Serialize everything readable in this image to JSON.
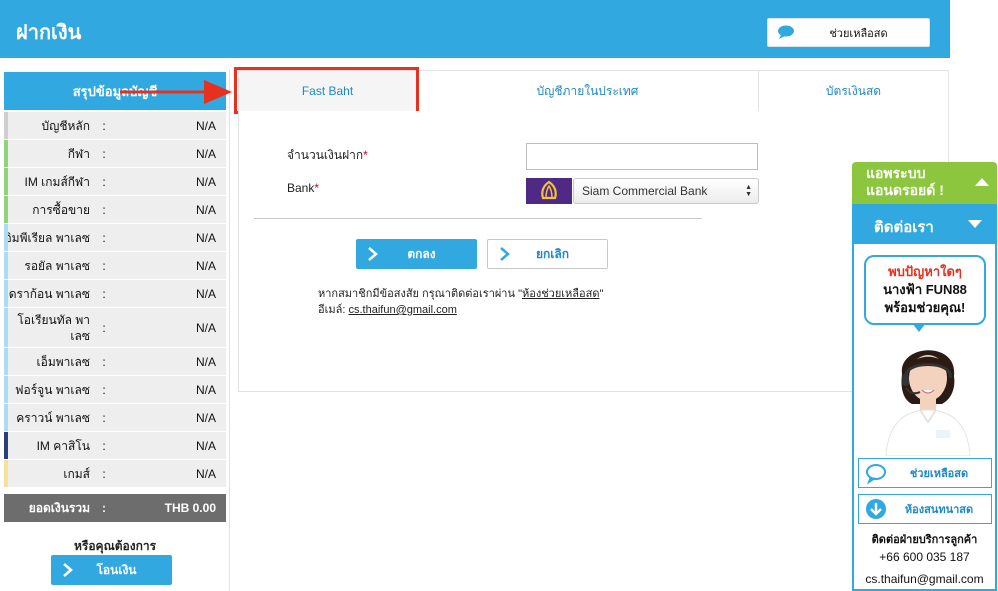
{
  "header": {
    "title": "ฝากเงิน",
    "help_label": "ช่วยเหลือสด"
  },
  "sidebar": {
    "title": "สรุปข้อมูลบัญชี",
    "rows": [
      {
        "name": "บัญชีหลัก",
        "value": "N/A",
        "color": "#cfcfcf"
      },
      {
        "name": "กีฬา",
        "value": "N/A",
        "color": "#8fd47a"
      },
      {
        "name": "IM เกมส์กีฬา",
        "value": "N/A",
        "color": "#8fd47a"
      },
      {
        "name": "การซื้อขาย",
        "value": "N/A",
        "color": "#8fd47a"
      },
      {
        "name": "อิมพีเรียล พาเลซ",
        "value": "N/A",
        "color": "#a9dcf5"
      },
      {
        "name": "รอยัล พาเลซ",
        "value": "N/A",
        "color": "#a9dcf5"
      },
      {
        "name": "ดราก้อน พาเลซ",
        "value": "N/A",
        "color": "#a9dcf5"
      },
      {
        "name": "โอเรียนทัล พาเลซ",
        "value": "N/A",
        "color": "#a9dcf5"
      },
      {
        "name": "เอ็มพาเลซ",
        "value": "N/A",
        "color": "#a9dcf5"
      },
      {
        "name": "ฟอร์จูน พาเลซ",
        "value": "N/A",
        "color": "#a9dcf5"
      },
      {
        "name": "คราวน์ พาเลซ",
        "value": "N/A",
        "color": "#a9dcf5"
      },
      {
        "name": "IM คาสิโน",
        "value": "N/A",
        "color": "#2b3f7a"
      },
      {
        "name": "เกมส์",
        "value": "N/A",
        "color": "#f6e39a"
      }
    ],
    "total": {
      "name": "ยอดเงินรวม",
      "value": "THB 0.00"
    },
    "colon": ":",
    "want_label": "หรือคุณต้องการ",
    "transfer_label": "โอนเงิน"
  },
  "tabs": [
    "Fast Baht",
    "บัญชีภายในประเทศ",
    "บัตรเงินสด"
  ],
  "form": {
    "amount_label": "จำนวนเงินฝาก",
    "amount_value": "",
    "bank_label": "Bank",
    "required_mark": "*",
    "bank_selected": "Siam Commercial Bank",
    "ok_label": "ตกลง",
    "cancel_label": "ยกเลิก",
    "note_prefix": "หากสมาชิกมีข้อสงสัย กรุณาติดต่อเราผ่าน \"",
    "note_link": "ห้องช่วยเหลือสด",
    "note_suffix": "\"",
    "email_label": "อีเมล์:",
    "email": "cs.thaifun@gmail.com"
  },
  "widget": {
    "android_line1": "แอพระบบ",
    "android_line2": "แอนดรอยด์ !",
    "contact_title": "ติดต่อเรา",
    "bubble_line1": "พบปัญหาใดๆ",
    "bubble_line2": "นางฟ้า FUN88",
    "bubble_line3": "พร้อมช่วยคุณ!",
    "live_help": "ช่วยเหลือสด",
    "chat_room": "ห้องสนทนาสด",
    "cs_title": "ติดต่อฝ่ายบริการลูกค้า",
    "phone": "+66 600 035 187",
    "email": "cs.thaifun@gmail.com"
  },
  "colors": {
    "primary": "#31a8e0",
    "highlight": "#e8301e",
    "android": "#8cc63f",
    "bank_brand": "#4e2a84"
  }
}
